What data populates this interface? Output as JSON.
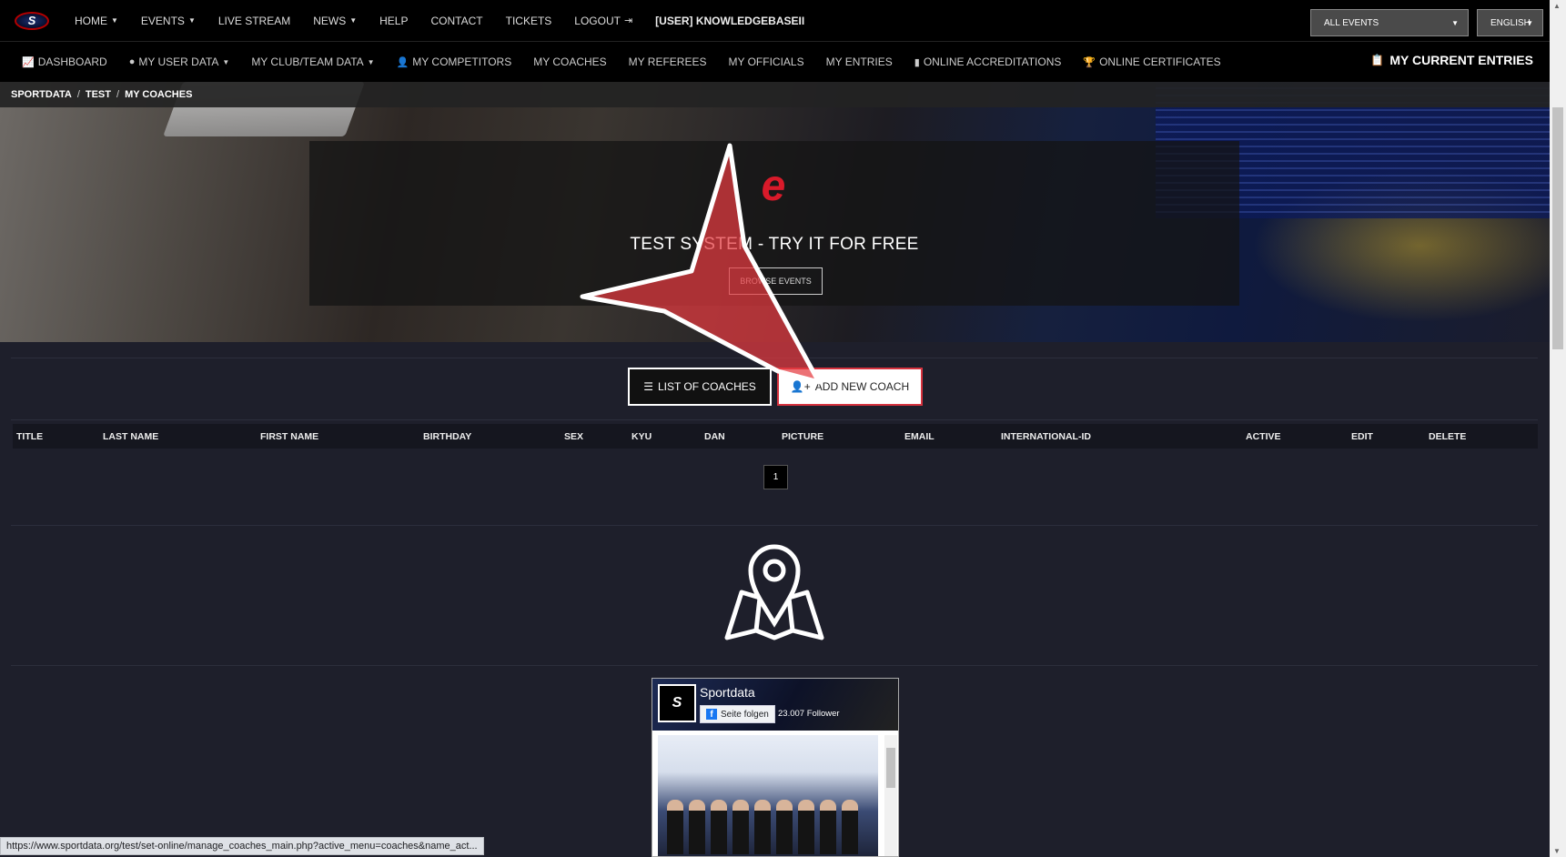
{
  "topnav": {
    "items": [
      {
        "label": "HOME",
        "caret": true
      },
      {
        "label": "EVENTS",
        "caret": true
      },
      {
        "label": "LIVE STREAM"
      },
      {
        "label": "NEWS",
        "caret": true
      },
      {
        "label": "HELP"
      },
      {
        "label": "CONTACT"
      },
      {
        "label": "TICKETS"
      },
      {
        "label": "LOGOUT",
        "icon": "logout-icon"
      },
      {
        "label": "[USER] KNOWLEDGEBASEII"
      }
    ],
    "events_select": "ALL EVENTS",
    "language_select": "ENGLISH"
  },
  "subnav": {
    "items": [
      {
        "label": "DASHBOARD",
        "icon": "chart-icon"
      },
      {
        "label": "MY USER DATA",
        "icon": "user-circle-icon",
        "caret": true
      },
      {
        "label": "MY CLUB/TEAM DATA",
        "caret": true
      },
      {
        "label": "MY COMPETITORS",
        "icon": "user-icon"
      },
      {
        "label": "MY COACHES"
      },
      {
        "label": "MY REFEREES"
      },
      {
        "label": "MY OFFICIALS"
      },
      {
        "label": "MY ENTRIES"
      },
      {
        "label": "ONLINE ACCREDITATIONS",
        "icon": "badge-icon"
      },
      {
        "label": "ONLINE CERTIFICATES",
        "icon": "trophy-icon"
      }
    ],
    "current_entries": "MY CURRENT ENTRIES"
  },
  "breadcrumb": [
    "SPORTDATA",
    "TEST",
    "MY COACHES"
  ],
  "hero": {
    "tagline": "TEST SYSTEM - TRY IT FOR FREE",
    "browse_label": "BROWSE EVENTS"
  },
  "actions": {
    "list_label": "LIST OF COACHES",
    "add_label": "ADD NEW COACH"
  },
  "table": {
    "columns": [
      "TITLE",
      "LAST NAME",
      "FIRST NAME",
      "BIRTHDAY",
      "SEX",
      "KYU",
      "DAN",
      "PICTURE",
      "EMAIL",
      "INTERNATIONAL-ID",
      "ACTIVE",
      "EDIT",
      "DELETE"
    ]
  },
  "pagination": {
    "current": "1"
  },
  "facebook": {
    "page_name": "Sportdata",
    "follow_label": "Seite folgen",
    "followers": "23.007 Follower"
  },
  "status_url": "https://www.sportdata.org/test/set-online/manage_coaches_main.php?active_menu=coaches&name_act...",
  "colors": {
    "background": "#1e1f2b",
    "nav": "#000000",
    "accent_red": "#d7333f"
  }
}
